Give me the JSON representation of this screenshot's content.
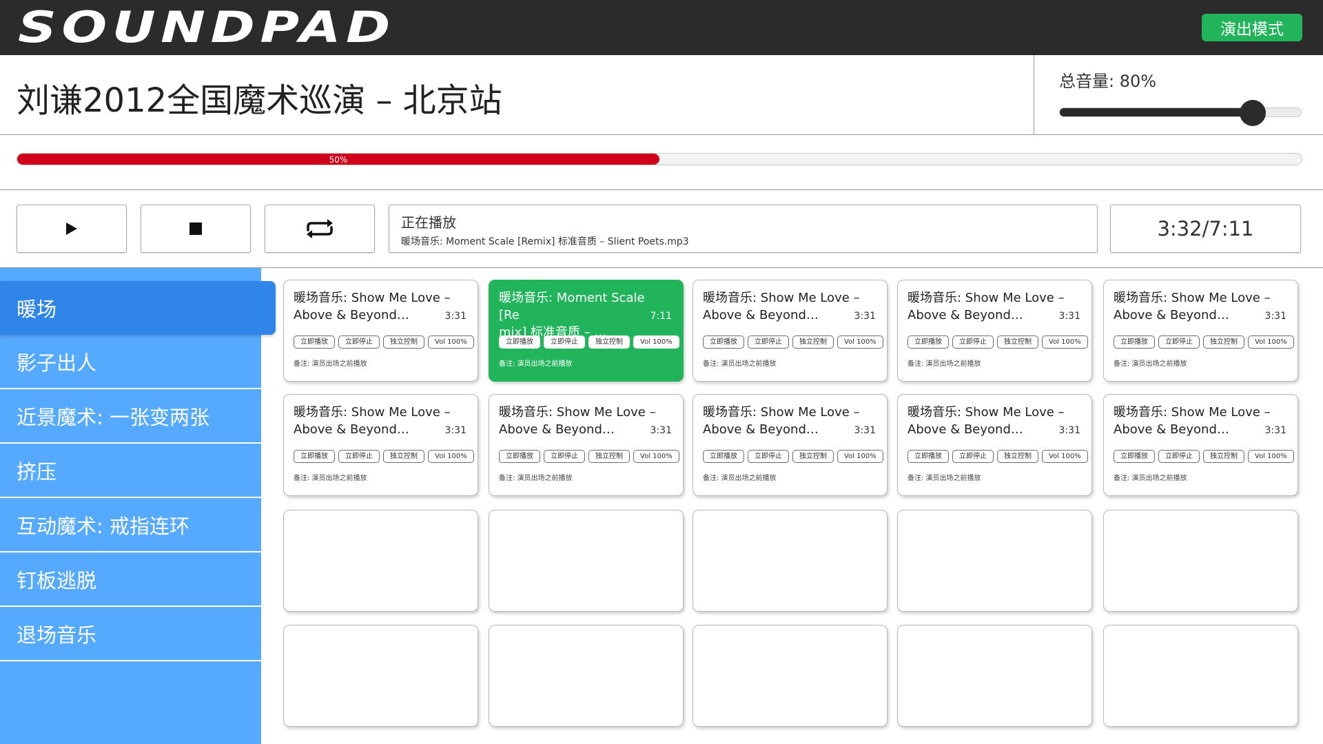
{
  "app": {
    "logo": "SOUNDPAD",
    "performance_mode_label": "演出模式"
  },
  "show_title": "刘谦2012全国魔术巡演 – 北京站",
  "master_volume": {
    "label": "总音量: 80%",
    "value": 0.8
  },
  "progress": {
    "value": 0.5,
    "label": "50%"
  },
  "controls": {
    "play": "play-icon",
    "stop": "stop-icon",
    "loop": "loop-icon"
  },
  "now_playing": {
    "label": "正在播放",
    "file": "暖场音乐: Moment Scale [Remix] 标准音质 – Slient Poets.mp3"
  },
  "time": "3:32/7:11",
  "sidebar": {
    "items": [
      {
        "label": "暖场"
      },
      {
        "label": "影子出人"
      },
      {
        "label": "近景魔术: 一张变两张"
      },
      {
        "label": "挤压"
      },
      {
        "label": "互动魔术: 戒指连环"
      },
      {
        "label": "钉板逃脱"
      },
      {
        "label": "退场音乐"
      }
    ],
    "active_index": 0
  },
  "card_buttons": {
    "play": "立即播放",
    "stop": "立即停止",
    "solo": "独立控制",
    "vol": "Vol 100%"
  },
  "cards": [
    {
      "title": "暖场音乐: Show Me Love –\nAbove & Beyond…",
      "duration": "3:31",
      "note": "备注: 演员出场之前播放"
    },
    {
      "title": "暖场音乐: Moment Scale [Re\nmix] 标准音质 – …",
      "duration": "7:11",
      "note": "备注: 演员出场之前播放",
      "active": true
    },
    {
      "title": "暖场音乐: Show Me Love –\nAbove & Beyond…",
      "duration": "3:31",
      "note": "备注: 演员出场之前播放"
    },
    {
      "title": "暖场音乐: Show Me Love –\nAbove & Beyond…",
      "duration": "3:31",
      "note": "备注: 演员出场之前播放"
    },
    {
      "title": "暖场音乐: Show Me Love –\nAbove & Beyond…",
      "duration": "3:31",
      "note": "备注: 演员出场之前播放"
    },
    {
      "title": "暖场音乐: Show Me Love –\nAbove & Beyond…",
      "duration": "3:31",
      "note": "备注: 演员出场之前播放"
    },
    {
      "title": "暖场音乐: Show Me Love –\nAbove & Beyond…",
      "duration": "3:31",
      "note": "备注: 演员出场之前播放"
    },
    {
      "title": "暖场音乐: Show Me Love –\nAbove & Beyond…",
      "duration": "3:31",
      "note": "备注: 演员出场之前播放"
    },
    {
      "title": "暖场音乐: Show Me Love –\nAbove & Beyond…",
      "duration": "3:31",
      "note": "备注: 演员出场之前播放"
    },
    {
      "title": "暖场音乐: Show Me Love –\nAbove & Beyond…",
      "duration": "3:31",
      "note": "备注: 演员出场之前播放"
    },
    {},
    {},
    {},
    {},
    {},
    {},
    {},
    {},
    {},
    {}
  ]
}
